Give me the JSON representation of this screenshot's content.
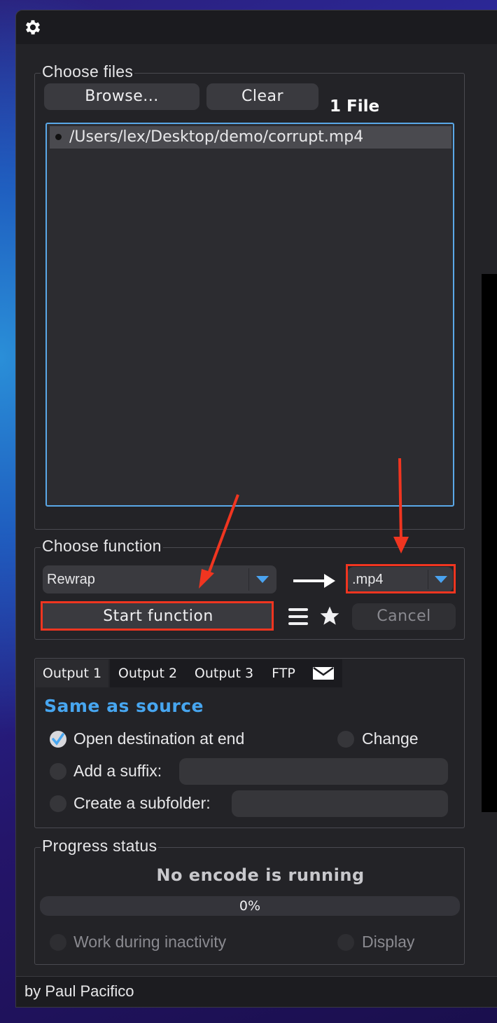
{
  "files": {
    "legend": "Choose files",
    "browse_label": "Browse...",
    "clear_label": "Clear",
    "count_label": "1 File",
    "items": [
      "/Users/lex/Desktop/demo/corrupt.mp4"
    ]
  },
  "function": {
    "legend": "Choose function",
    "selected": "Rewrap",
    "extension": ".mp4",
    "start_label": "Start function",
    "cancel_label": "Cancel"
  },
  "output": {
    "tabs": [
      "Output 1",
      "Output 2",
      "Output 3",
      "FTP"
    ],
    "destination": "Same as source",
    "open_destination_label": "Open destination at end",
    "open_destination_checked": true,
    "change_label": "Change",
    "suffix_label": "Add a suffix:",
    "suffix_value": "",
    "subfolder_label": "Create a subfolder:",
    "subfolder_value": ""
  },
  "progress": {
    "legend": "Progress status",
    "status": "No encode is running",
    "percent_label": "0%",
    "percent": 0,
    "inactivity_label": "Work during inactivity",
    "display_label": "Display"
  },
  "footer": {
    "credit": "by Paul Pacifico"
  },
  "icons": {
    "settings": "gear-icon",
    "arrow": "right-arrow-icon",
    "menu": "menu-lines-icon",
    "favorite": "star-icon",
    "mail": "envelope-icon"
  },
  "colors": {
    "accent": "#47a6f0",
    "annotation": "#f03520",
    "window_bg": "#232327"
  }
}
